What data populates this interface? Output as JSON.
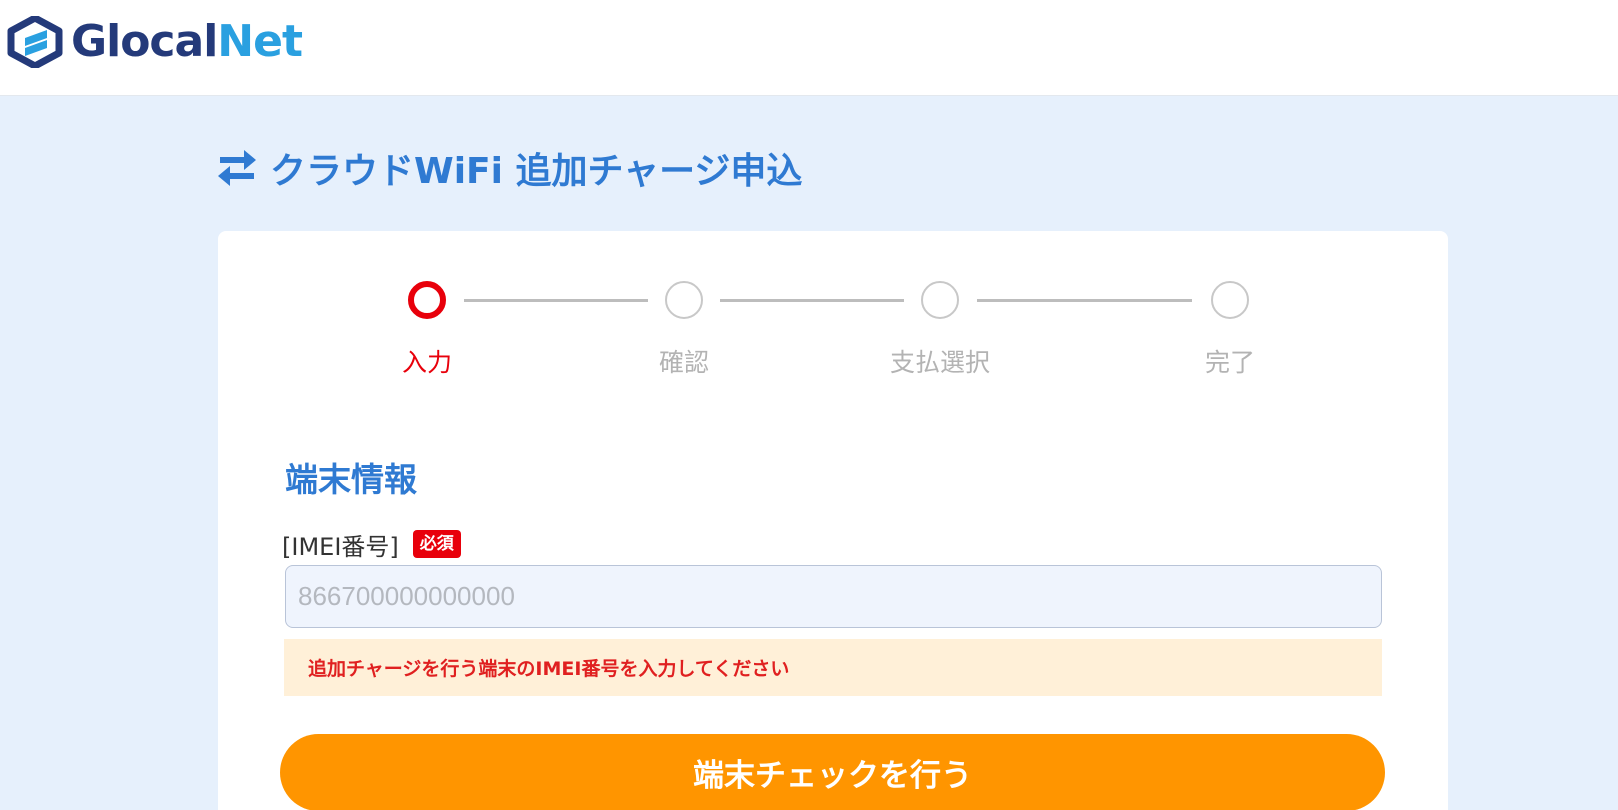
{
  "header": {
    "logo": {
      "part1": "Glocal",
      "part2": "Net",
      "icon": "glocalnet-logo-icon"
    }
  },
  "page": {
    "title": "クラウドWiFi 追加チャージ申込",
    "title_icon": "exchange-arrows-icon"
  },
  "steps": [
    {
      "label": "入力",
      "state": "active"
    },
    {
      "label": "確認",
      "state": "inactive"
    },
    {
      "label": "支払選択",
      "state": "inactive"
    },
    {
      "label": "完了",
      "state": "inactive"
    }
  ],
  "section": {
    "title": "端末情報",
    "imei_label": "[IMEI番号]",
    "required_badge": "必須",
    "imei_placeholder": "866700000000000",
    "imei_value": "",
    "hint": "追加チャージを行う端末のIMEI番号を入力してください"
  },
  "actions": {
    "check_label": "端末チェックを行う"
  },
  "colors": {
    "page_bg": "#e6f0fc",
    "accent_blue": "#2f7ad2",
    "active_red": "#e8000b",
    "button_orange": "#ff9500",
    "hint_bg": "#fff0d8"
  }
}
